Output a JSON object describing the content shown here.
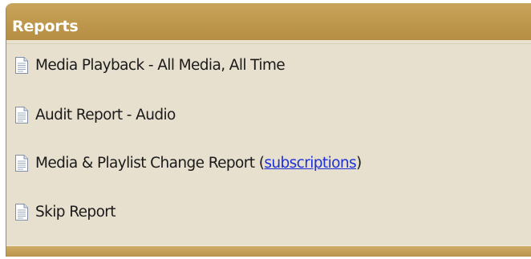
{
  "panel": {
    "title": "Reports",
    "header_color": "#bd974c",
    "body_color": "#e8e0cf"
  },
  "reports": [
    {
      "label": "Media Playback - All Media, All Time",
      "icon": "document-icon"
    },
    {
      "label": "Audit Report - Audio",
      "icon": "document-icon"
    },
    {
      "label": "Media & Playlist Change Report (",
      "link": "subscriptions",
      "suffix": ")",
      "icon": "document-icon"
    },
    {
      "label": "Skip Report",
      "icon": "document-icon"
    }
  ],
  "link_color": "#1d2fd6"
}
